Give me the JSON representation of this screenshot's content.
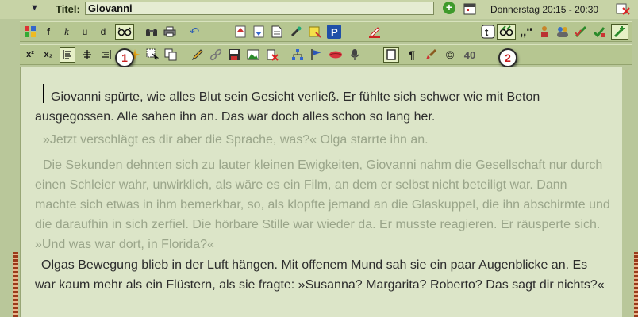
{
  "title_bar": {
    "title_label": "Titel:",
    "title_value": "Giovanni",
    "date_range": "Donnerstag 20:15 - 20:30"
  },
  "toolbar1": {
    "bold": "f",
    "italic": "k",
    "underline": "u",
    "strike": "d"
  },
  "toolbar2": {
    "superscript": "x²",
    "subscript": "x₂",
    "word_count": "40"
  },
  "badges": {
    "badge1": "1",
    "badge2": "2"
  },
  "editor": {
    "p1": "Giovanni spürte, wie alles Blut sein Gesicht verließ. Er fühlte sich schwer wie mit Beton ausgegossen. Alle sahen ihn an. Das war doch alles schon so lang her.",
    "p2": "»Jetzt verschlägt es dir aber die Sprache, was?« Olga starrte ihn an.",
    "p3": "Die Sekunden dehnten sich zu lauter kleinen Ewigkeiten, Giovanni nahm die Gesellschaft nur durch einen Schleier wahr, unwirklich, als wäre es ein Film, an dem er selbst nicht beteiligt war. Dann machte sich etwas in ihm bemerkbar, so, als klopfte jemand an die Glaskuppel, die ihn abschirmte und die daraufhin in sich zerfiel. Die hörbare Stille war wieder da. Er musste reagieren. Er räusperte sich. »Und was war dort, in Florida?«",
    "p4": "Olgas Bewegung blieb in der Luft hängen. Mit offenem Mund sah sie ein paar Augenblicke an. Es war kaum mehr als ein Flüstern, als sie fragte: »Susanna? Margarita? Roberto? Das sagt dir nichts?«"
  },
  "colors": {
    "toolbar": "#b6c691",
    "editor_bg": "#dce5c8",
    "badge_text": "#c81d1d"
  }
}
